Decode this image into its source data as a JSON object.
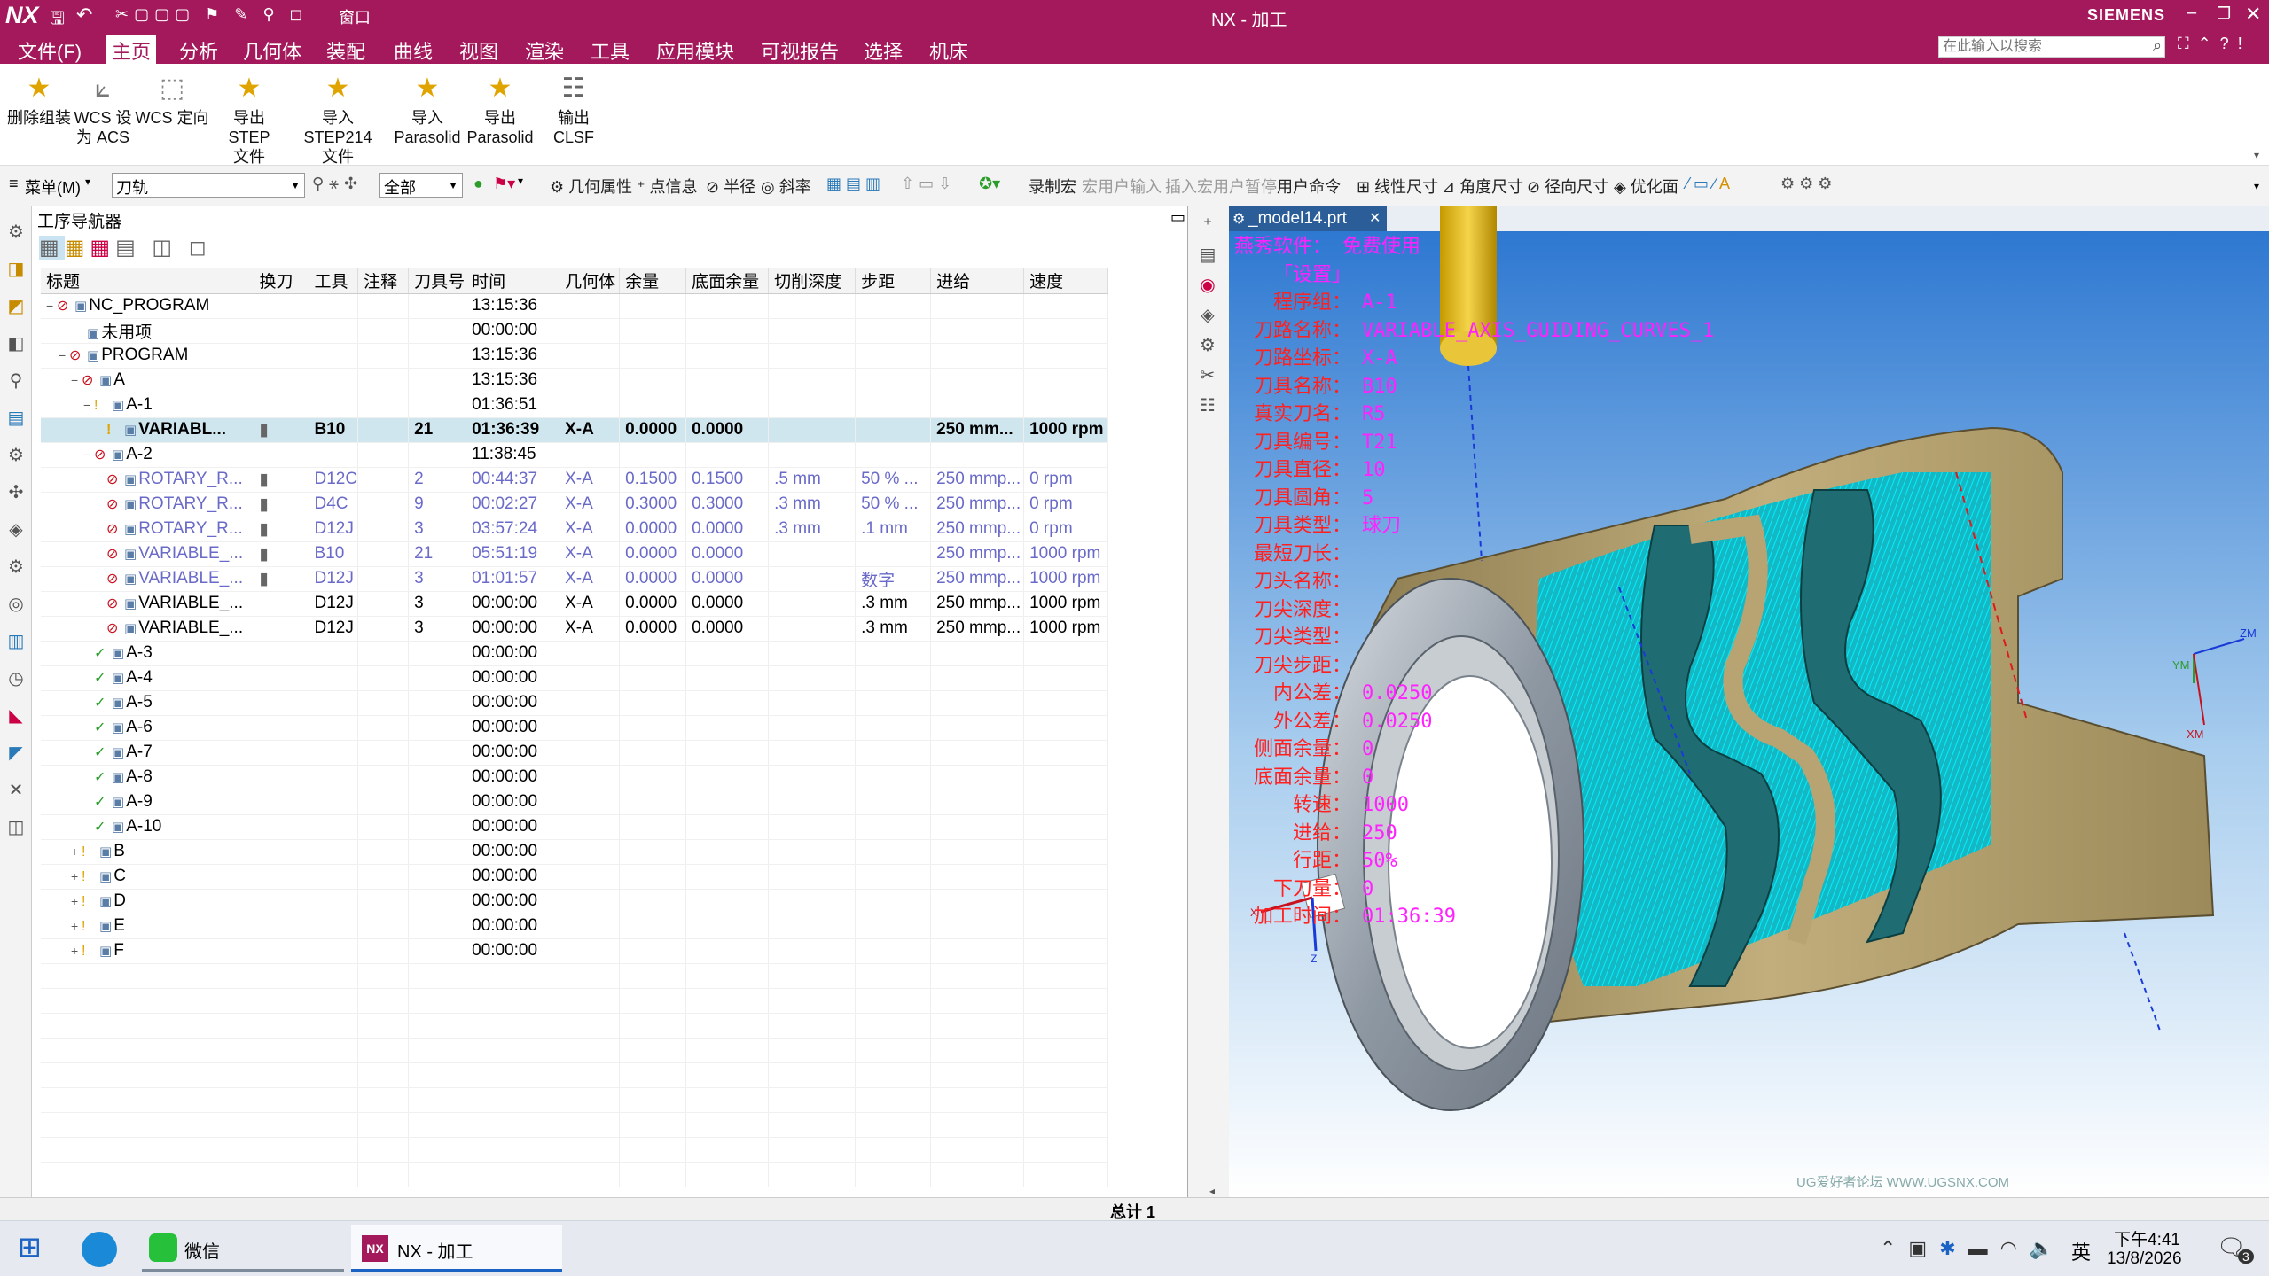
{
  "titlebar": {
    "logo": "NX",
    "window_menu": "窗口",
    "title": "NX - 加工",
    "brand": "SIEMENS"
  },
  "menubar": {
    "items": [
      "文件(F)",
      "主页",
      "分析",
      "几何体",
      "装配",
      "曲线",
      "视图",
      "渲染",
      "工具",
      "应用模块",
      "可视报告",
      "选择",
      "机床"
    ],
    "search_placeholder": "在此输入以搜索"
  },
  "ribbon": {
    "buttons": [
      {
        "label1": "删除组装",
        "label2": ""
      },
      {
        "label1": "WCS 设",
        "label2": "为 ACS"
      },
      {
        "label1": "WCS 定向",
        "label2": ""
      },
      {
        "label1": "导出 STEP",
        "label2": "文件"
      },
      {
        "label1": "导入 STEP214",
        "label2": "文件"
      },
      {
        "label1": "导入",
        "label2": "Parasolid"
      },
      {
        "label1": "导出",
        "label2": "Parasolid"
      },
      {
        "label1": "输出 CLSF",
        "label2": ""
      }
    ]
  },
  "toolbar2": {
    "menu": "菜单(M)",
    "filter_value": "刀轨",
    "scope_value": "全部",
    "items": [
      "几何属性",
      "点信息",
      "半径",
      "斜率",
      "录制宏",
      "宏用户输入",
      "插入宏用户暂停",
      "用户命令",
      "线性尺寸",
      "角度尺寸",
      "径向尺寸",
      "优化面"
    ]
  },
  "navigator": {
    "title": "工序导航器",
    "columns": [
      "标题",
      "换刀",
      "工具",
      "注释",
      "刀具号",
      "时间",
      "几何体",
      "余量",
      "底面余量",
      "切削深度",
      "步距",
      "进给",
      "速度"
    ],
    "rows": [
      {
        "name": "NC_PROGRAM",
        "tool": "",
        "num": "",
        "time": "13:15:36",
        "geom": "",
        "stock": "",
        "floor": "",
        "depth": "",
        "step": "",
        "feed": "",
        "speed": ""
      },
      {
        "name": "未用项",
        "tool": "",
        "num": "",
        "time": "00:00:00",
        "geom": "",
        "stock": "",
        "floor": "",
        "depth": "",
        "step": "",
        "feed": "",
        "speed": ""
      },
      {
        "name": "PROGRAM",
        "tool": "",
        "num": "",
        "time": "13:15:36",
        "geom": "",
        "stock": "",
        "floor": "",
        "depth": "",
        "step": "",
        "feed": "",
        "speed": ""
      },
      {
        "name": "A",
        "tool": "",
        "num": "",
        "time": "13:15:36",
        "geom": "",
        "stock": "",
        "floor": "",
        "depth": "",
        "step": "",
        "feed": "",
        "speed": ""
      },
      {
        "name": "A-1",
        "tool": "",
        "num": "",
        "time": "01:36:51",
        "geom": "",
        "stock": "",
        "floor": "",
        "depth": "",
        "step": "",
        "feed": "",
        "speed": ""
      },
      {
        "name": "VARIABL...",
        "tool": "B10",
        "num": "21",
        "time": "01:36:39",
        "geom": "X-A",
        "stock": "0.0000",
        "floor": "0.0000",
        "depth": "",
        "step": "",
        "feed": "250 mm...",
        "speed": "1000 rpm"
      },
      {
        "name": "A-2",
        "tool": "",
        "num": "",
        "time": "11:38:45",
        "geom": "",
        "stock": "",
        "floor": "",
        "depth": "",
        "step": "",
        "feed": "",
        "speed": ""
      },
      {
        "name": "ROTARY_R...",
        "tool": "D12C",
        "num": "2",
        "time": "00:44:37",
        "geom": "X-A",
        "stock": "0.1500",
        "floor": "0.1500",
        "depth": ".5 mm",
        "step": "50 % ...",
        "feed": "250 mmp...",
        "speed": "0 rpm"
      },
      {
        "name": "ROTARY_R...",
        "tool": "D4C",
        "num": "9",
        "time": "00:02:27",
        "geom": "X-A",
        "stock": "0.3000",
        "floor": "0.3000",
        "depth": ".3 mm",
        "step": "50 % ...",
        "feed": "250 mmp...",
        "speed": "0 rpm"
      },
      {
        "name": "ROTARY_R...",
        "tool": "D12J",
        "num": "3",
        "time": "03:57:24",
        "geom": "X-A",
        "stock": "0.0000",
        "floor": "0.0000",
        "depth": ".3 mm",
        "step": ".1 mm",
        "feed": "250 mmp...",
        "speed": "0 rpm"
      },
      {
        "name": "VARIABLE_...",
        "tool": "B10",
        "num": "21",
        "time": "05:51:19",
        "geom": "X-A",
        "stock": "0.0000",
        "floor": "0.0000",
        "depth": "",
        "step": "",
        "feed": "250 mmp...",
        "speed": "1000 rpm"
      },
      {
        "name": "VARIABLE_...",
        "tool": "D12J",
        "num": "3",
        "time": "01:01:57",
        "geom": "X-A",
        "stock": "0.0000",
        "floor": "0.0000",
        "depth": "",
        "step": "数字",
        "feed": "250 mmp...",
        "speed": "1000 rpm"
      },
      {
        "name": "VARIABLE_...",
        "tool": "D12J",
        "num": "3",
        "time": "00:00:00",
        "geom": "X-A",
        "stock": "0.0000",
        "floor": "0.0000",
        "depth": "",
        "step": ".3 mm",
        "feed": "250 mmp...",
        "speed": "1000 rpm"
      },
      {
        "name": "VARIABLE_...",
        "tool": "D12J",
        "num": "3",
        "time": "00:00:00",
        "geom": "X-A",
        "stock": "0.0000",
        "floor": "0.0000",
        "depth": "",
        "step": ".3 mm",
        "feed": "250 mmp...",
        "speed": "1000 rpm"
      },
      {
        "name": "A-3",
        "tool": "",
        "num": "",
        "time": "00:00:00",
        "geom": "",
        "stock": "",
        "floor": "",
        "depth": "",
        "step": "",
        "feed": "",
        "speed": ""
      },
      {
        "name": "A-4",
        "tool": "",
        "num": "",
        "time": "00:00:00",
        "geom": "",
        "stock": "",
        "floor": "",
        "depth": "",
        "step": "",
        "feed": "",
        "speed": ""
      },
      {
        "name": "A-5",
        "tool": "",
        "num": "",
        "time": "00:00:00",
        "geom": "",
        "stock": "",
        "floor": "",
        "depth": "",
        "step": "",
        "feed": "",
        "speed": ""
      },
      {
        "name": "A-6",
        "tool": "",
        "num": "",
        "time": "00:00:00",
        "geom": "",
        "stock": "",
        "floor": "",
        "depth": "",
        "step": "",
        "feed": "",
        "speed": ""
      },
      {
        "name": "A-7",
        "tool": "",
        "num": "",
        "time": "00:00:00",
        "geom": "",
        "stock": "",
        "floor": "",
        "depth": "",
        "step": "",
        "feed": "",
        "speed": ""
      },
      {
        "name": "A-8",
        "tool": "",
        "num": "",
        "time": "00:00:00",
        "geom": "",
        "stock": "",
        "floor": "",
        "depth": "",
        "step": "",
        "feed": "",
        "speed": ""
      },
      {
        "name": "A-9",
        "tool": "",
        "num": "",
        "time": "00:00:00",
        "geom": "",
        "stock": "",
        "floor": "",
        "depth": "",
        "step": "",
        "feed": "",
        "speed": ""
      },
      {
        "name": "A-10",
        "tool": "",
        "num": "",
        "time": "00:00:00",
        "geom": "",
        "stock": "",
        "floor": "",
        "depth": "",
        "step": "",
        "feed": "",
        "speed": ""
      },
      {
        "name": "B",
        "tool": "",
        "num": "",
        "time": "00:00:00",
        "geom": "",
        "stock": "",
        "floor": "",
        "depth": "",
        "step": "",
        "feed": "",
        "speed": ""
      },
      {
        "name": "C",
        "tool": "",
        "num": "",
        "time": "00:00:00",
        "geom": "",
        "stock": "",
        "floor": "",
        "depth": "",
        "step": "",
        "feed": "",
        "speed": ""
      },
      {
        "name": "D",
        "tool": "",
        "num": "",
        "time": "00:00:00",
        "geom": "",
        "stock": "",
        "floor": "",
        "depth": "",
        "step": "",
        "feed": "",
        "speed": ""
      },
      {
        "name": "E",
        "tool": "",
        "num": "",
        "time": "00:00:00",
        "geom": "",
        "stock": "",
        "floor": "",
        "depth": "",
        "step": "",
        "feed": "",
        "speed": ""
      },
      {
        "name": "F",
        "tool": "",
        "num": "",
        "time": "00:00:00",
        "geom": "",
        "stock": "",
        "floor": "",
        "depth": "",
        "step": "",
        "feed": "",
        "speed": ""
      }
    ]
  },
  "viewport": {
    "tab": "_model14.prt",
    "info": [
      {
        "label": "",
        "value": "免费使用",
        "extra": "燕秀软件："
      },
      {
        "label": "「设置」",
        "value": ""
      },
      {
        "label": "程序组：",
        "value": "A-1"
      },
      {
        "label": "刀路名称：",
        "value": "VARIABLE_AXIS_GUIDING_CURVES_1"
      },
      {
        "label": "刀路坐标：",
        "value": "X-A"
      },
      {
        "label": "刀具名称：",
        "value": "B10"
      },
      {
        "label": "真实刀名：",
        "value": "R5"
      },
      {
        "label": "刀具编号：",
        "value": "T21"
      },
      {
        "label": "刀具直径：",
        "value": "10"
      },
      {
        "label": "刀具圆角：",
        "value": "5"
      },
      {
        "label": "刀具类型：",
        "value": "球刀"
      },
      {
        "label": "最短刀长：",
        "value": ""
      },
      {
        "label": "刀头名称：",
        "value": ""
      },
      {
        "label": "刀尖深度：",
        "value": ""
      },
      {
        "label": "刀尖类型：",
        "value": ""
      },
      {
        "label": "刀尖步距：",
        "value": ""
      },
      {
        "label": "内公差：",
        "value": "0.0250"
      },
      {
        "label": "外公差：",
        "value": "0.0250"
      },
      {
        "label": "侧面余量：",
        "value": "0"
      },
      {
        "label": "底面余量：",
        "value": "0"
      },
      {
        "label": "转速：",
        "value": "1000"
      },
      {
        "label": "进给：",
        "value": "250"
      },
      {
        "label": "行距：",
        "value": "50%"
      },
      {
        "label": "下刀量：",
        "value": "0"
      },
      {
        "label": "加工时间：",
        "value": "01:36:39"
      }
    ],
    "axis_labels": {
      "zm": "ZM",
      "ym": "YM",
      "xm": "XM",
      "x": "X",
      "z": "Z"
    },
    "watermark": "UG爱好者论坛 WWW.UGSNX.COM"
  },
  "status": {
    "total": "总计 1"
  },
  "taskbar": {
    "apps": [
      "微信",
      "NX - 加工"
    ],
    "ime": "英",
    "time": "下午4:41",
    "date": "13/8/2026",
    "notify_count": "3"
  },
  "colors": {
    "accent": "#a3195b",
    "selection": "#cfe6ee",
    "cyan_path": "#00e5f0",
    "part_gold": "#b8a472",
    "info_label": "#ff2020",
    "info_value": "#ff22ff"
  }
}
